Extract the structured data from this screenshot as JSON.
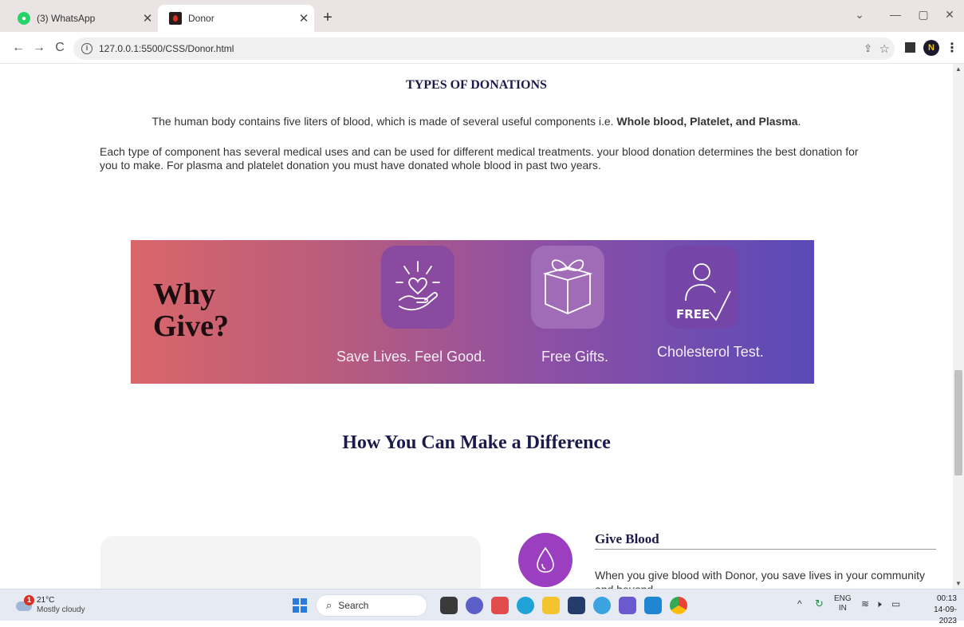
{
  "browser": {
    "tabs": [
      {
        "title": "(3) WhatsApp",
        "active": false
      },
      {
        "title": "Donor",
        "active": true
      }
    ],
    "new_tab": "+",
    "url": "127.0.0.1:5500/CSS/Donor.html",
    "profile_initial": "N"
  },
  "page": {
    "types_title": "TYPES OF DONATIONS",
    "para1_prefix": "The human body contains five liters of blood, which is made of several useful components i.e. ",
    "para1_bold1": "Whole blood",
    "para1_sep1": ", ",
    "para1_bold2": "Platelet, and Plasma",
    "para1_end": ".",
    "para2": "Each type of component has several medical uses and can be used for different medical treatments. your blood donation determines the best donation for you to make. For plasma and platelet donation you must have donated whole blood in past two years.",
    "banner": {
      "why_line1": "Why",
      "why_line2": "Give?",
      "benefits": [
        "Save Lives. Feel Good.",
        "Free Gifts.",
        "Cholesterol Test."
      ],
      "free_badge": "FREE"
    },
    "difference_title": "How You Can Make a Difference",
    "give_blood": {
      "title": "Give Blood",
      "text": "When you give blood with Donor, you save lives in your community and beyond."
    }
  },
  "taskbar": {
    "weather_badge": "1",
    "temperature": "21°C",
    "condition": "Mostly cloudy",
    "search_label": "Search",
    "lang_line1": "ENG",
    "lang_line2": "IN",
    "time": "00:13",
    "date": "14-09-2023"
  }
}
